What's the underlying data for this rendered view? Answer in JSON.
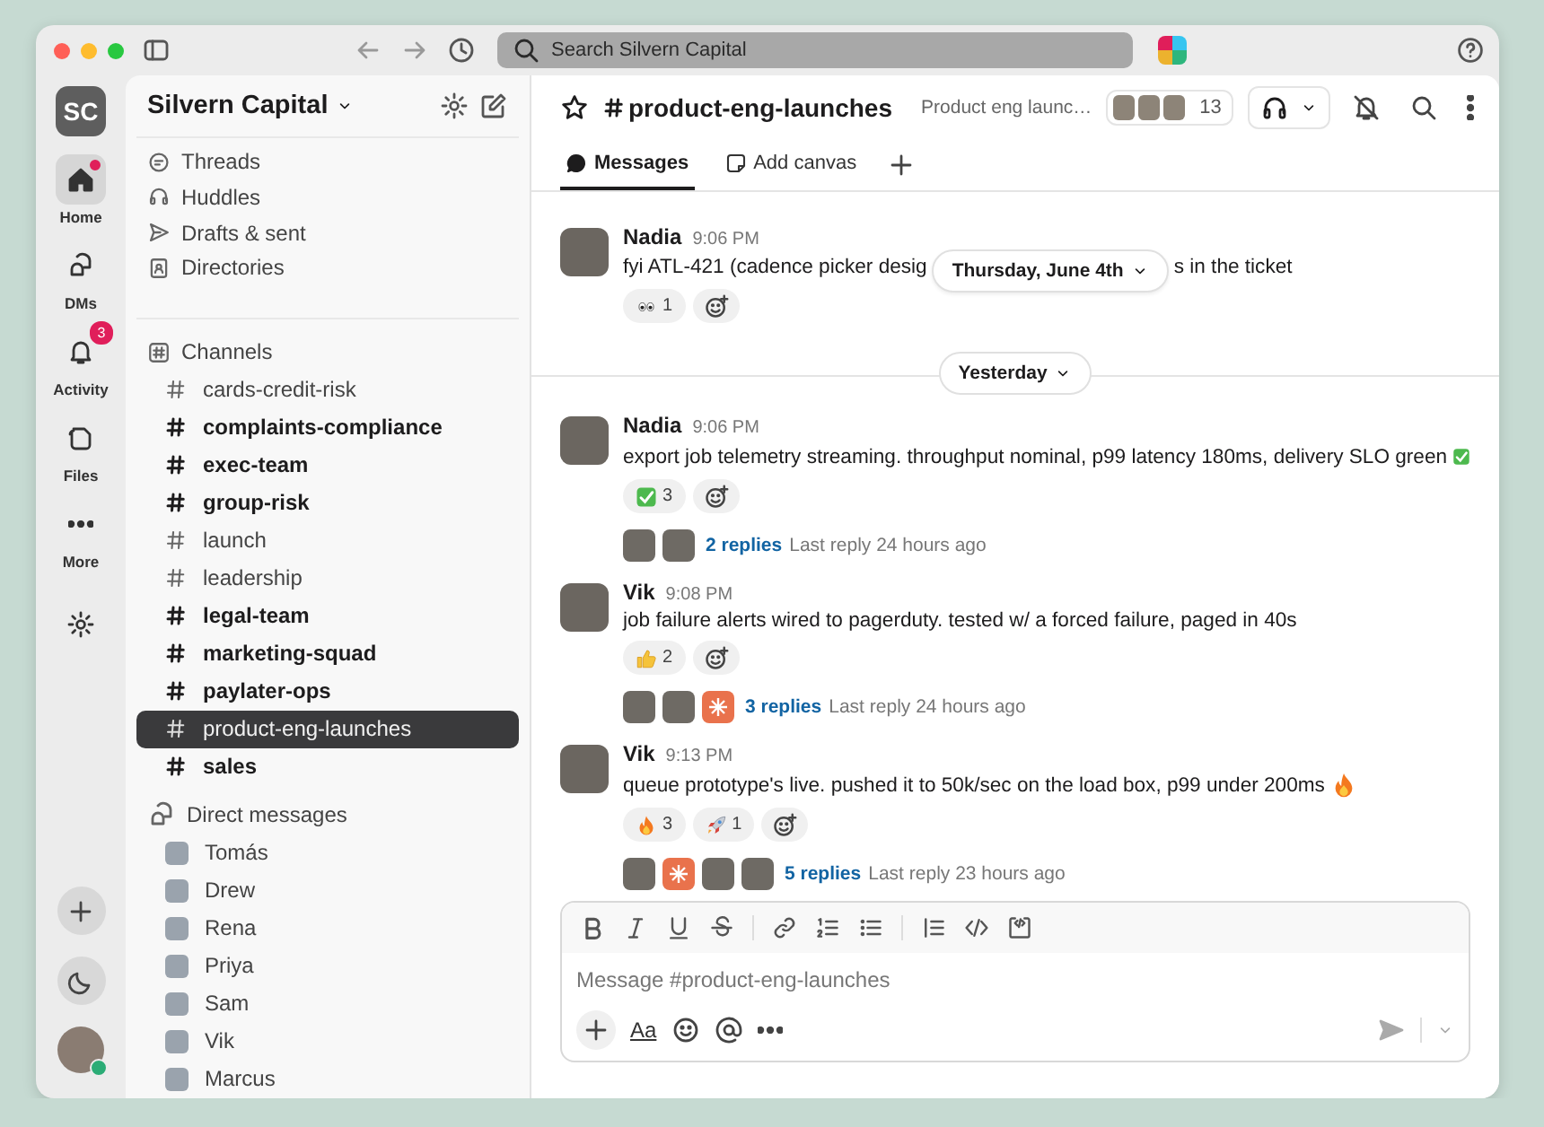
{
  "window": {
    "search_placeholder": "Search Silvern Capital"
  },
  "rail": {
    "workspace_initials": "SC",
    "items": [
      {
        "label": "Home",
        "kind": "home",
        "selected": true,
        "dot": true
      },
      {
        "label": "DMs",
        "kind": "dms",
        "selected": false,
        "dot": false
      },
      {
        "label": "Activity",
        "kind": "activity",
        "selected": false,
        "dot": false,
        "badge": "3"
      },
      {
        "label": "Files",
        "kind": "files",
        "selected": false,
        "dot": false
      },
      {
        "label": "More",
        "kind": "more",
        "selected": false,
        "dot": false
      }
    ]
  },
  "sidebar": {
    "workspace": "Silvern Capital",
    "nav": [
      {
        "label": "Threads",
        "kind": "threads"
      },
      {
        "label": "Huddles",
        "kind": "huddles"
      },
      {
        "label": "Drafts & sent",
        "kind": "drafts"
      },
      {
        "label": "Directories",
        "kind": "directories"
      }
    ],
    "channels": {
      "title": "Channels",
      "items": [
        {
          "name": "cards-credit-risk",
          "unread": false,
          "selected": false
        },
        {
          "name": "complaints-compliance",
          "unread": true,
          "selected": false
        },
        {
          "name": "exec-team",
          "unread": true,
          "selected": false
        },
        {
          "name": "group-risk",
          "unread": true,
          "selected": false
        },
        {
          "name": "launch",
          "unread": false,
          "selected": false
        },
        {
          "name": "leadership",
          "unread": false,
          "selected": false
        },
        {
          "name": "legal-team",
          "unread": true,
          "selected": false
        },
        {
          "name": "marketing-squad",
          "unread": true,
          "selected": false
        },
        {
          "name": "paylater-ops",
          "unread": true,
          "selected": false
        },
        {
          "name": "product-eng-launches",
          "unread": false,
          "selected": true
        },
        {
          "name": "sales",
          "unread": true,
          "selected": false
        }
      ]
    },
    "direct_messages": {
      "title": "Direct messages",
      "items": [
        {
          "name": "Tomás"
        },
        {
          "name": "Drew"
        },
        {
          "name": "Rena"
        },
        {
          "name": "Priya"
        },
        {
          "name": "Sam"
        },
        {
          "name": "Vik"
        },
        {
          "name": "Marcus"
        }
      ]
    }
  },
  "channel": {
    "name": "product-eng-launches",
    "topic": "Product eng launc…",
    "member_count": "13",
    "tabs": [
      {
        "label": "Messages",
        "kind": "messages",
        "selected": true
      },
      {
        "label": "Add canvas",
        "kind": "canvas",
        "selected": false
      }
    ]
  },
  "sticky_date": "Thursday, June 4th",
  "timeline": [
    {
      "kind": "message",
      "author": "Nadia",
      "time": "9:06 PM",
      "text": "fyi ATL-421 (cadence picker desig",
      "text_tail": "s in the ticket",
      "reactions": [
        {
          "kind": "eyes",
          "count": "1"
        }
      ]
    },
    {
      "kind": "divider",
      "label": "Yesterday"
    },
    {
      "kind": "message",
      "author": "Nadia",
      "time": "9:06 PM",
      "text": "export job telemetry streaming. throughput nominal, p99 latency 180ms, delivery SLO green",
      "trailing_icon": {
        "kind": "check"
      },
      "reactions": [
        {
          "kind": "check",
          "count": "3"
        }
      ],
      "thread": {
        "avatars": [
          {
            "kind": "photo"
          },
          {
            "kind": "photo"
          }
        ],
        "replies": "2 replies",
        "last_reply": "Last reply 24 hours ago"
      }
    },
    {
      "kind": "message",
      "author": "Vik",
      "time": "9:08 PM",
      "text": "job failure alerts wired to pagerduty. tested w/ a forced failure, paged in 40s",
      "reactions": [
        {
          "kind": "thumbs-up",
          "count": "2"
        }
      ],
      "thread": {
        "avatars": [
          {
            "kind": "photo"
          },
          {
            "kind": "photo"
          },
          {
            "kind": "sunburst"
          }
        ],
        "replies": "3 replies",
        "last_reply": "Last reply 24 hours ago"
      }
    },
    {
      "kind": "message",
      "author": "Vik",
      "time": "9:13 PM",
      "text": "queue prototype's live. pushed it to 50k/sec on the load box, p99 under 200ms",
      "trailing_icon": {
        "kind": "fire"
      },
      "reactions": [
        {
          "kind": "fire",
          "count": "3"
        },
        {
          "kind": "rocket",
          "count": "1"
        }
      ],
      "thread": {
        "avatars": [
          {
            "kind": "photo"
          },
          {
            "kind": "sunburst"
          },
          {
            "kind": "photo"
          },
          {
            "kind": "photo"
          }
        ],
        "replies": "5 replies",
        "last_reply": "Last reply 23 hours ago"
      }
    }
  ],
  "composer": {
    "placeholder": "Message #product-eng-launches",
    "format_label": "Aa"
  }
}
